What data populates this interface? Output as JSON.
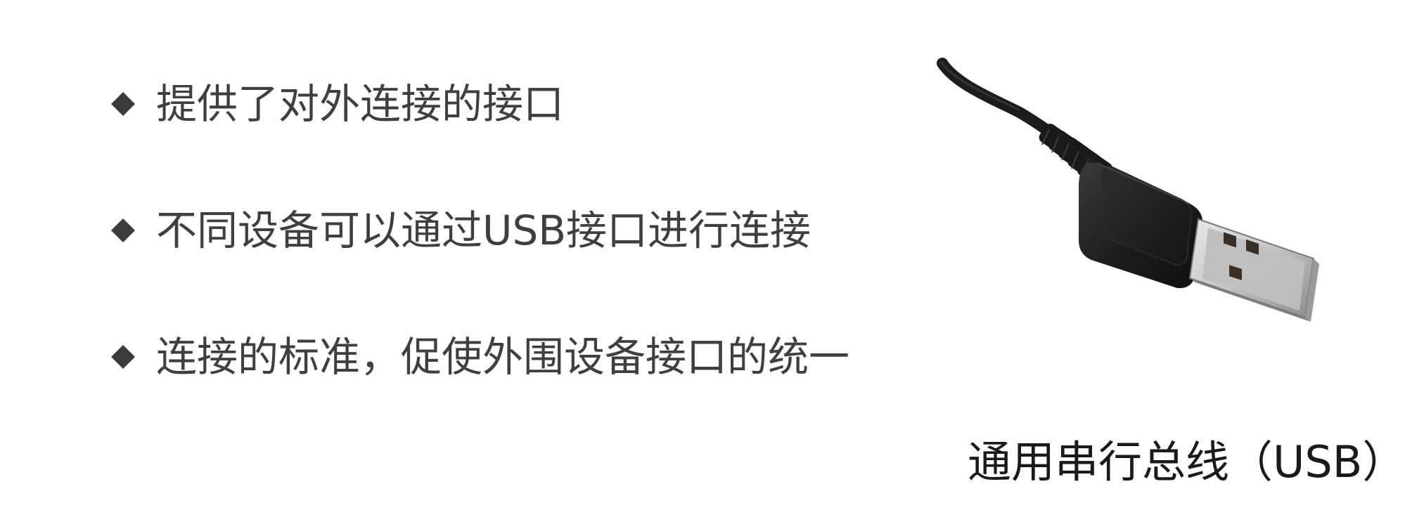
{
  "slide": {
    "bullets": [
      "提供了对外连接的接口",
      "不同设备可以通过USB接口进行连接",
      "连接的标准，促使外围设备接口的统一"
    ],
    "bullet_icon": "diamond-icon",
    "image_icon": "usb-cable-icon",
    "caption": "通用串行总线（USB）",
    "colors": {
      "bullet_text": "#3f3f3f",
      "caption_text": "#1a1a1a",
      "background": "#ffffff"
    }
  }
}
